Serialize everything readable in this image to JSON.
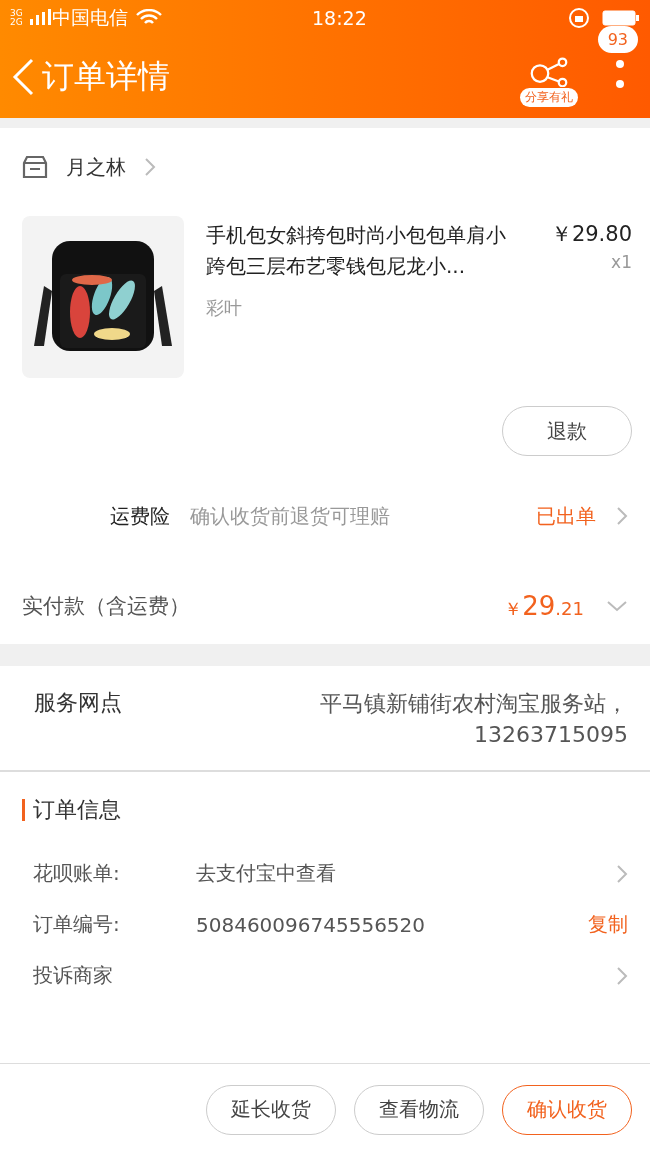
{
  "status_bar": {
    "network": "3G 2G",
    "carrier": "中国电信",
    "time": "18:22"
  },
  "header": {
    "title": "订单详情",
    "share_label": "分享有礼",
    "badge": "93"
  },
  "shop": {
    "name": "月之林"
  },
  "item": {
    "kind": "picture",
    "title": "手机包女斜挎包时尚小包包单肩小跨包三层布艺零钱包尼龙小...",
    "spec": "彩叶",
    "price": "￥29.80",
    "quantity": "x1",
    "action": "退款"
  },
  "insurance": {
    "label": "运费险",
    "description": "确认收货前退货可理赔",
    "status": "已出单"
  },
  "payment": {
    "label": "实付款（含运费）",
    "currency": "￥",
    "amount_main": "29",
    "amount_decimal": ".21"
  },
  "service_point": {
    "label": "服务网点",
    "value": "平马镇新铺街农村淘宝服务站，13263715095"
  },
  "order_info": {
    "title": "订单信息",
    "rows": [
      {
        "kind": "link",
        "label": "花呗账单:",
        "value": "去支付宝中查看"
      },
      {
        "kind": "copy",
        "label": "订单编号:",
        "value": "508460096745556520",
        "action": "复制"
      },
      {
        "kind": "link",
        "label": "投诉商家"
      }
    ]
  },
  "actions": [
    {
      "label": "延长收货",
      "kind": "normal"
    },
    {
      "label": "查看物流",
      "kind": "normal"
    },
    {
      "label": "确认收货",
      "kind": "primary"
    }
  ]
}
